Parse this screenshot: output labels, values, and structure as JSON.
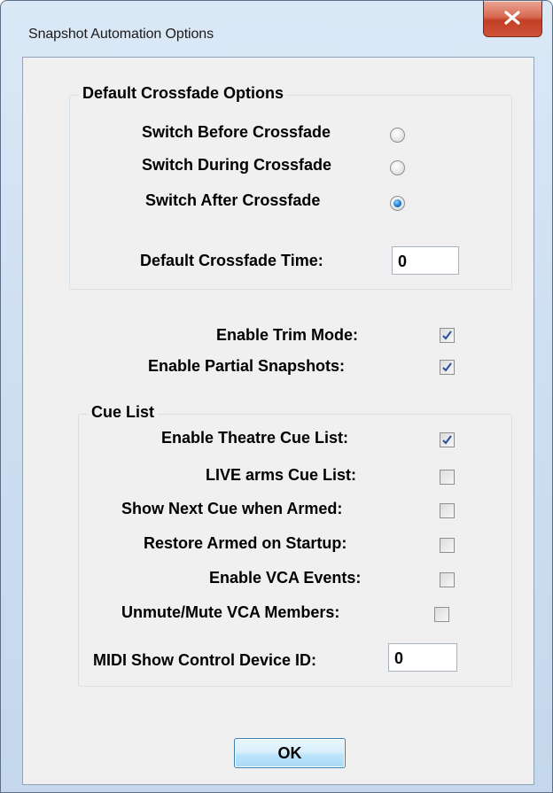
{
  "window": {
    "title": "Snapshot Automation Options",
    "close_icon": "x-close-icon"
  },
  "crossfade_group": {
    "title": "Default Crossfade Options",
    "options": [
      {
        "label": "Switch Before Crossfade",
        "selected": false
      },
      {
        "label": "Switch During Crossfade",
        "selected": false
      },
      {
        "label": "Switch After Crossfade",
        "selected": true
      }
    ],
    "time_label": "Default Crossfade Time:",
    "time_value": "0"
  },
  "options": {
    "trim_mode_label": "Enable Trim Mode:",
    "trim_mode_checked": true,
    "partial_snapshots_label": "Enable Partial Snapshots:",
    "partial_snapshots_checked": true
  },
  "cue_list_group": {
    "title": "Cue List",
    "items": [
      {
        "label": "Enable Theatre Cue List:",
        "checked": true
      },
      {
        "label": "LIVE arms Cue List:",
        "checked": false
      },
      {
        "label": "Show Next Cue when Armed:",
        "checked": false
      },
      {
        "label": "Restore Armed on Startup:",
        "checked": false
      },
      {
        "label": "Enable VCA Events:",
        "checked": false
      },
      {
        "label": "Unmute/Mute VCA Members:",
        "checked": false
      }
    ],
    "midi_label": "MIDI Show Control Device ID:",
    "midi_value": "0"
  },
  "ok_label": "OK",
  "colors": {
    "accent": "#1a7ad0",
    "close": "#c13f24",
    "dialog_bg": "#f0f0f0"
  }
}
